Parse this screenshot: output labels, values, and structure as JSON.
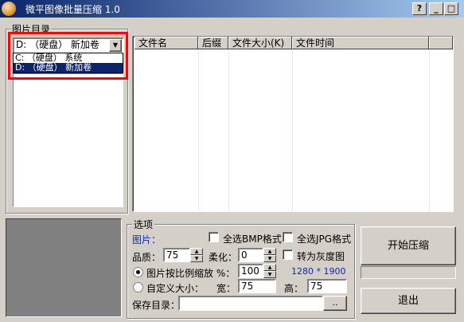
{
  "window": {
    "title": "微平图像批量压缩 1.0",
    "help_label": "?",
    "min_label": "_",
    "max_label": "□"
  },
  "dir_panel": {
    "group_label": "图片目录",
    "drive_selected": "D: （硬盘） 新加卷",
    "drive_options": [
      "C: （硬盘） 系统",
      "D: （硬盘） 新加卷"
    ],
    "highlight_color": "#ff0000"
  },
  "file_table": {
    "columns": [
      "文件名",
      "后缀",
      "文件大小(K)",
      "文件时间"
    ],
    "rows": []
  },
  "options": {
    "group_label": "选项",
    "picture_label": "图片：",
    "select_bmp": "全选BMP格式",
    "select_jpg": "全选JPG格式",
    "quality_label": "品质：",
    "quality_value": "75",
    "soften_label": "柔化：",
    "soften_value": "0",
    "grayscale_label": "转为灰度图",
    "scale_label": "图片按比例缩放 %：",
    "scale_value": "100",
    "dimensions_text": "1280 * 1900",
    "custom_label": "自定义大小：",
    "width_label": "宽：",
    "width_value": "75",
    "height_label": "高：",
    "height_value": "75",
    "save_dir_label": "保存目录：",
    "save_dir_value": "",
    "browse_label": ".."
  },
  "buttons": {
    "start": "开始压缩",
    "exit": "退出"
  }
}
